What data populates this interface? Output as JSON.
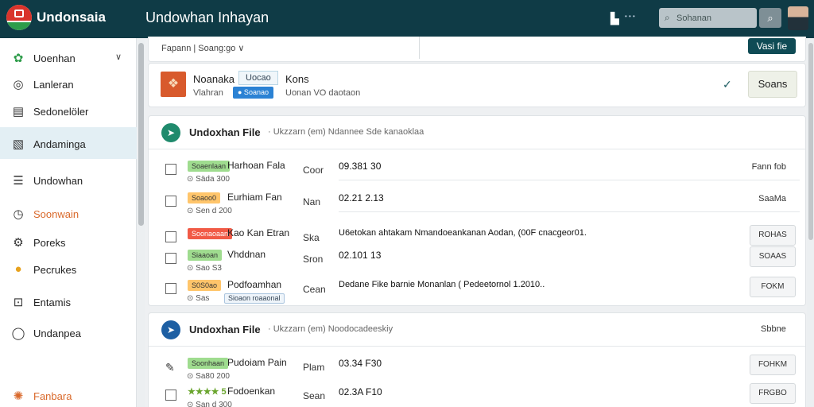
{
  "header": {
    "brand": "Undonsaia",
    "title": "Undowhan Inhayan",
    "icon_dots": "• • •",
    "search_placeholder": "Sohanan",
    "search_icon": "search-icon"
  },
  "sidebar": {
    "items": [
      {
        "label": "Uoenhan",
        "icon": "gear-icon",
        "glyph": "✿",
        "expand": "∨"
      },
      {
        "label": "Lanleran",
        "icon": "target-icon",
        "glyph": "◎"
      },
      {
        "label": "Sedonelöler",
        "icon": "clipboard-icon",
        "glyph": "▤"
      },
      {
        "label": "Andaminga",
        "icon": "image-icon",
        "glyph": "▧"
      },
      {
        "label": "Undowhan",
        "icon": "list-icon",
        "glyph": "☰"
      },
      {
        "label": "Soonwain",
        "icon": "clock-icon",
        "glyph": "◷"
      },
      {
        "label": "Poreks",
        "icon": "cog-icon",
        "glyph": "⚙"
      },
      {
        "label": "Pecrukes",
        "icon": "coin-icon",
        "glyph": "●"
      },
      {
        "label": "Entamis",
        "icon": "chart-icon",
        "glyph": "⊡"
      },
      {
        "label": "Undanpea",
        "icon": "chat-icon",
        "glyph": "◯"
      },
      {
        "label": "Fanbara",
        "icon": "settings-icon",
        "glyph": "✺"
      }
    ]
  },
  "filterbar": {
    "label": "Fapann  |  Soang:go  ∨",
    "view_button": "Vasi fie"
  },
  "item": {
    "name": "Noanaka",
    "tag": "Uocao",
    "right": "Kons",
    "sub": "Vlahran",
    "sub_tag": "● Soanao",
    "sub2": "Uonan VO daotaon",
    "check": "✓",
    "button": "Soans"
  },
  "section1": {
    "title": "Undoxhan File",
    "subtitle": "· Ukzzarn (em)   Ndannee Sde kanaoklaa",
    "right": "",
    "rows": [
      {
        "badge": "Soaenlaan",
        "badge_style": "green",
        "name": "Harhoan Fala",
        "meta": "⊙ Säda  300",
        "tag": "",
        "type": "Coor",
        "value": "09.381 30",
        "text": "Fann fob",
        "button": ""
      },
      {
        "badge": "Soaoo0",
        "badge_style": "orange",
        "name": "Eurhiam Fan",
        "meta": "⊙ Sen  d  200",
        "tag": "",
        "type": "Nan",
        "value": "02.21 2.13",
        "text": "SaaMa",
        "button": ""
      },
      {
        "badge": "Soonaoaan",
        "badge_style": "red",
        "name": "Kao Kan Etran",
        "meta": "",
        "tag": "",
        "type": "Ska",
        "value": "U6etokan ahtakam Nmandoeankanan Aodan, (00F cnacgeor01.",
        "text": "",
        "button": "ROHAS"
      },
      {
        "badge": "Siaaoan",
        "badge_style": "green",
        "name": "Vhddnan",
        "meta": "⊙ Sao  S3",
        "tag": "",
        "type": "Sron",
        "value": "02.101 13",
        "text": "",
        "button": "SOAAS"
      },
      {
        "badge": "S0S0ao",
        "badge_style": "orange",
        "name": "Podfoamhan",
        "meta": "⊙ Sas",
        "tag": "Sioaon roaaonal",
        "type": "Cean",
        "value": "Dedane Fike barnie Monanlan ( Pedeetornol 1.2010..",
        "text": "",
        "button": "FOKM"
      }
    ]
  },
  "section2": {
    "title": "Undoxhan File",
    "subtitle": "· Ukzzarn (em)   Noodocadeeskiy",
    "right": "Sbbne",
    "rows": [
      {
        "badge": "Soonhaan",
        "badge_style": "green",
        "name": "Pudoiam Pain",
        "meta": "⊙ Sa80  200",
        "tag": "",
        "type": "Plam",
        "value": "03.34 F30",
        "text": "",
        "button": "FOHKM"
      },
      {
        "badge": "★★★★ 5",
        "badge_style": "stars",
        "name": "Fodoenkan",
        "meta": "⊙ San  d  300",
        "tag": "",
        "type": "Sean",
        "value": "02.3A F10",
        "text": "",
        "button": "FRGBO"
      }
    ]
  }
}
